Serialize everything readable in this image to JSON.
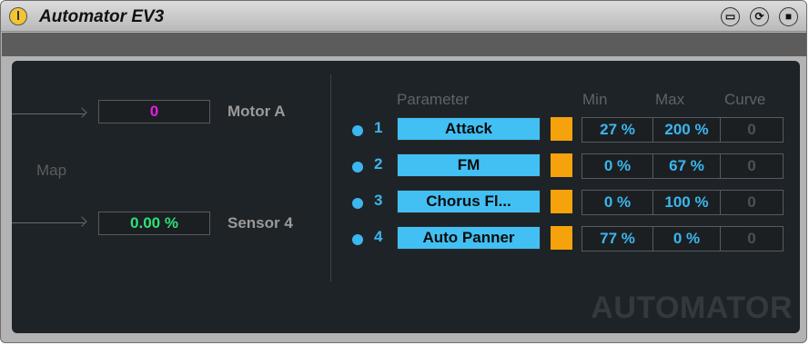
{
  "app": {
    "title": "Automator EV3"
  },
  "title_buttons": [
    {
      "icon": "window-icon",
      "glyph": "▭"
    },
    {
      "icon": "refresh-icon",
      "glyph": "⟳"
    },
    {
      "icon": "save-icon",
      "glyph": "■"
    }
  ],
  "left": {
    "map_label": "Map",
    "motor": {
      "value": "0",
      "label": "Motor A",
      "value_color": "#e21fe0"
    },
    "sensor": {
      "value": "0.00 %",
      "label": "Sensor 4",
      "value_color": "#2fe07a"
    }
  },
  "table": {
    "headers": {
      "parameter": "Parameter",
      "min": "Min",
      "max": "Max",
      "curve": "Curve"
    },
    "rows": [
      {
        "index": "1",
        "parameter": "Attack",
        "min": "27 %",
        "max": "200 %",
        "curve": "0"
      },
      {
        "index": "2",
        "parameter": "FM",
        "min": "0 %",
        "max": "67 %",
        "curve": "0"
      },
      {
        "index": "3",
        "parameter": "Chorus Fl...",
        "min": "0 %",
        "max": "100 %",
        "curve": "0"
      },
      {
        "index": "4",
        "parameter": "Auto Panner",
        "min": "77 %",
        "max": "0 %",
        "curve": "0"
      }
    ]
  },
  "watermark": "AUTOMATOR",
  "colors": {
    "accent_blue": "#42c0f4",
    "orange": "#f6a20c",
    "panel_bg": "#1e2327"
  }
}
